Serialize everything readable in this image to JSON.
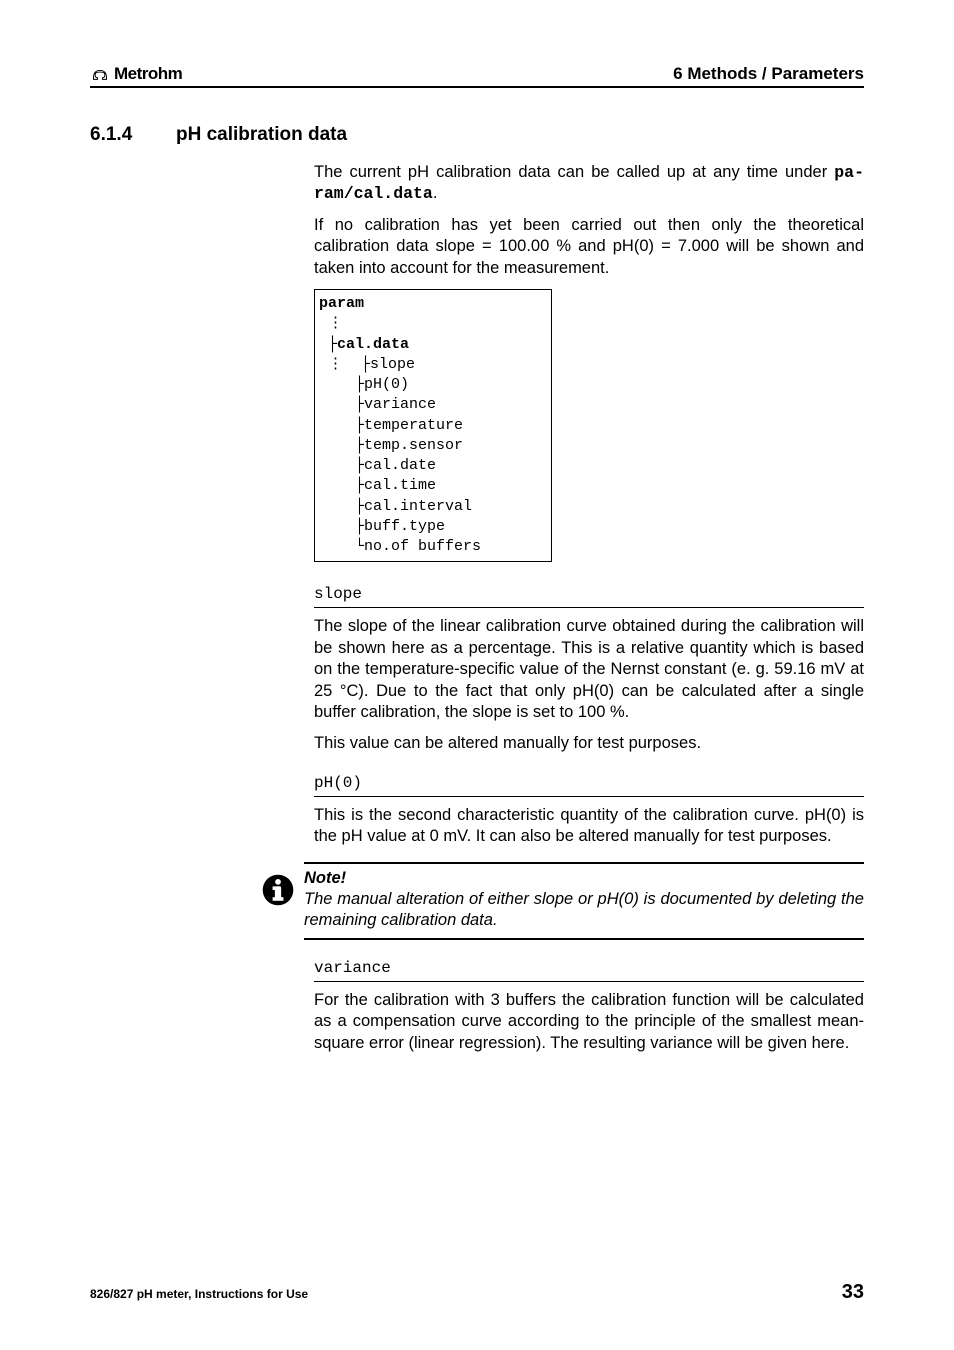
{
  "header": {
    "logo_text": "Metrohm",
    "breadcrumb": "6 Methods / Parameters"
  },
  "section": {
    "number": "6.1.4",
    "title": "pH calibration data"
  },
  "intro": {
    "p1a": "The current pH calibration data can be called up at any time under ",
    "p1b": "pa-ram/cal.data",
    "p1c": ".",
    "p2": "If no calibration has yet been carried out then only the theoretical calibration data slope = 100.00 % and pH(0) = 7.000 will be shown and taken into account for the measurement."
  },
  "tree": {
    "root": "param",
    "node": "cal.data",
    "items": [
      "slope",
      "pH(0)",
      "variance",
      "temperature",
      "temp.sensor",
      "cal.date",
      "cal.time",
      "cal.interval",
      "buff.type",
      "no.of buffers"
    ]
  },
  "slope": {
    "heading": "slope",
    "p1": "The slope of the linear calibration curve obtained during the calibration will be shown here as a percentage. This is a relative quantity which is based on the temperature-specific value of the Nernst constant (e. g. 59.16 mV at 25 °C). Due to the fact that only pH(0) can be calculated after a single buffer calibration, the slope is set to 100 %.",
    "p2": "This value can be altered manually for test purposes."
  },
  "ph0": {
    "heading": "pH(0)",
    "p1": "This is the second characteristic quantity of the calibration curve. pH(0) is the pH value at 0 mV. It can also be altered manually for test purposes."
  },
  "note": {
    "title": "Note!",
    "body": "The manual alteration of either slope or pH(0) is documented by deleting the remaining calibration data."
  },
  "variance": {
    "heading": "variance",
    "p1": "For the calibration with 3 buffers the calibration function will be calculated as a compensation curve according to the principle of the smallest mean-square error (linear regression). The resulting variance will be given here."
  },
  "footer": {
    "left": "826/827 pH meter, Instructions for Use",
    "page": "33"
  }
}
